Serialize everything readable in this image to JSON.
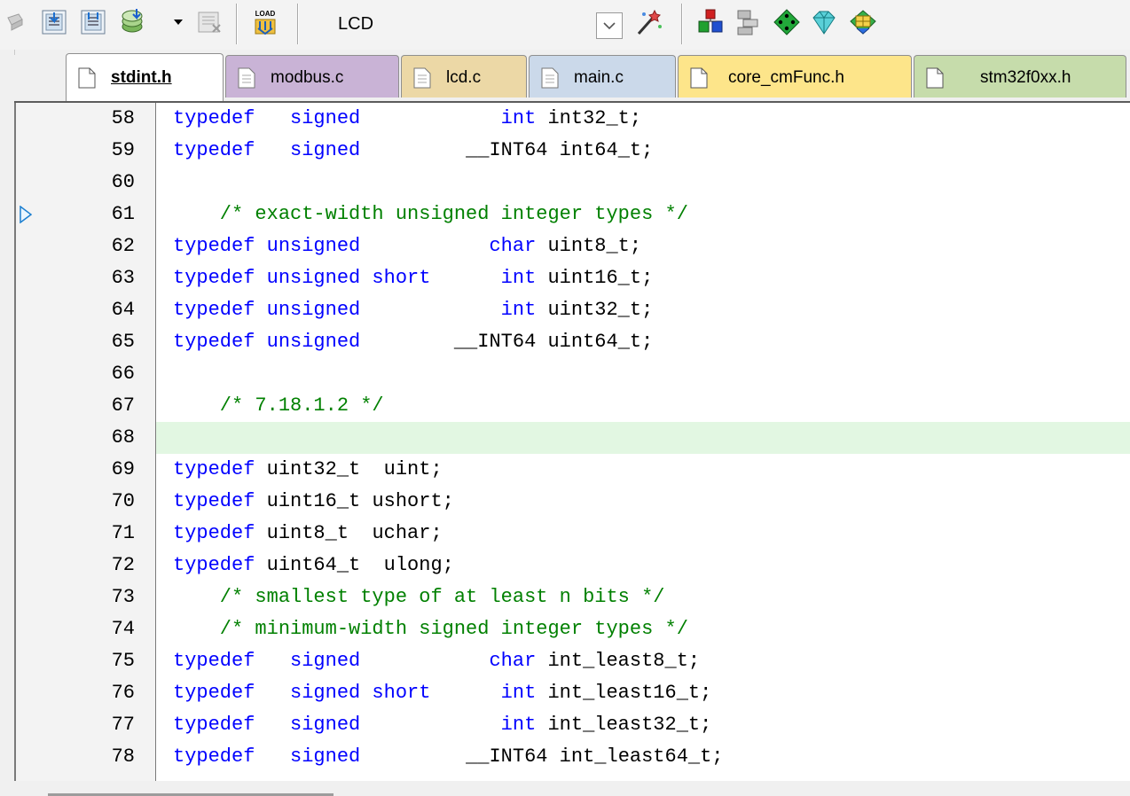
{
  "toolbar": {
    "buttons": [
      {
        "name": "translate-icon",
        "state": "disabled"
      },
      {
        "name": "build-icon"
      },
      {
        "name": "rebuild-icon"
      },
      {
        "name": "batch-build-icon"
      },
      {
        "name": "stop-build-icon",
        "state": "disabled"
      },
      {
        "name": "download-load-icon"
      },
      {
        "name": "options-for-target-icon"
      },
      {
        "name": "manage-project-items-icon"
      },
      {
        "name": "select-software-packs-icon"
      },
      {
        "name": "pack-installer-icon"
      },
      {
        "name": "manage-run-time-environment-icon"
      }
    ],
    "load_glyph_text": "LOAD",
    "target_name": "LCD"
  },
  "tabs": [
    {
      "label": "stdint.h",
      "active": true,
      "color": "#ffffff"
    },
    {
      "label": "modbus.c",
      "active": false,
      "color": "#c9b3d6"
    },
    {
      "label": "lcd.c",
      "active": false,
      "color": "#ecd8a6"
    },
    {
      "label": "main.c",
      "active": false,
      "color": "#cbd9ea"
    },
    {
      "label": "core_cmFunc.h",
      "active": false,
      "color": "#fde58a"
    },
    {
      "label": "stm32f0xx.h",
      "active": false,
      "color": "#c6dcab"
    }
  ],
  "editor": {
    "current_line": 68,
    "exec_marker_line": 61,
    "lines": [
      {
        "n": "58",
        "segments": [
          [
            "kw",
            "typedef   signed            int "
          ],
          [
            "tx",
            "int32_t;"
          ]
        ]
      },
      {
        "n": "59",
        "segments": [
          [
            "kw",
            "typedef   signed         "
          ],
          [
            "tx",
            "__INT64 int64_t;"
          ]
        ]
      },
      {
        "n": "60",
        "segments": []
      },
      {
        "n": "61",
        "segments": [
          [
            "cm",
            "    /* exact-width unsigned integer types */"
          ]
        ]
      },
      {
        "n": "62",
        "segments": [
          [
            "kw",
            "typedef unsigned           char "
          ],
          [
            "tx",
            "uint8_t;"
          ]
        ]
      },
      {
        "n": "63",
        "segments": [
          [
            "kw",
            "typedef unsigned short      int "
          ],
          [
            "tx",
            "uint16_t;"
          ]
        ]
      },
      {
        "n": "64",
        "segments": [
          [
            "kw",
            "typedef unsigned            int "
          ],
          [
            "tx",
            "uint32_t;"
          ]
        ]
      },
      {
        "n": "65",
        "segments": [
          [
            "kw",
            "typedef unsigned        "
          ],
          [
            "tx",
            "__INT64 uint64_t;"
          ]
        ]
      },
      {
        "n": "66",
        "segments": []
      },
      {
        "n": "67",
        "segments": [
          [
            "cm",
            "    /* 7.18.1.2 */"
          ]
        ]
      },
      {
        "n": "68",
        "segments": []
      },
      {
        "n": "69",
        "segments": [
          [
            "kw",
            "typedef "
          ],
          [
            "tx",
            "uint32_t  uint;"
          ]
        ]
      },
      {
        "n": "70",
        "segments": [
          [
            "kw",
            "typedef "
          ],
          [
            "tx",
            "uint16_t ushort;"
          ]
        ]
      },
      {
        "n": "71",
        "segments": [
          [
            "kw",
            "typedef "
          ],
          [
            "tx",
            "uint8_t  uchar;"
          ]
        ]
      },
      {
        "n": "72",
        "segments": [
          [
            "kw",
            "typedef "
          ],
          [
            "tx",
            "uint64_t  ulong;"
          ]
        ]
      },
      {
        "n": "73",
        "segments": [
          [
            "cm",
            "    /* smallest type of at least n bits */"
          ]
        ]
      },
      {
        "n": "74",
        "segments": [
          [
            "cm",
            "    /* minimum-width signed integer types */"
          ]
        ]
      },
      {
        "n": "75",
        "segments": [
          [
            "kw",
            "typedef   signed           char "
          ],
          [
            "tx",
            "int_least8_t;"
          ]
        ]
      },
      {
        "n": "76",
        "segments": [
          [
            "kw",
            "typedef   signed short      int "
          ],
          [
            "tx",
            "int_least16_t;"
          ]
        ]
      },
      {
        "n": "77",
        "segments": [
          [
            "kw",
            "typedef   signed            int "
          ],
          [
            "tx",
            "int_least32_t;"
          ]
        ]
      },
      {
        "n": "78",
        "segments": [
          [
            "kw",
            "typedef   signed         "
          ],
          [
            "tx",
            "__INT64 int_least64_t;"
          ]
        ]
      }
    ]
  }
}
